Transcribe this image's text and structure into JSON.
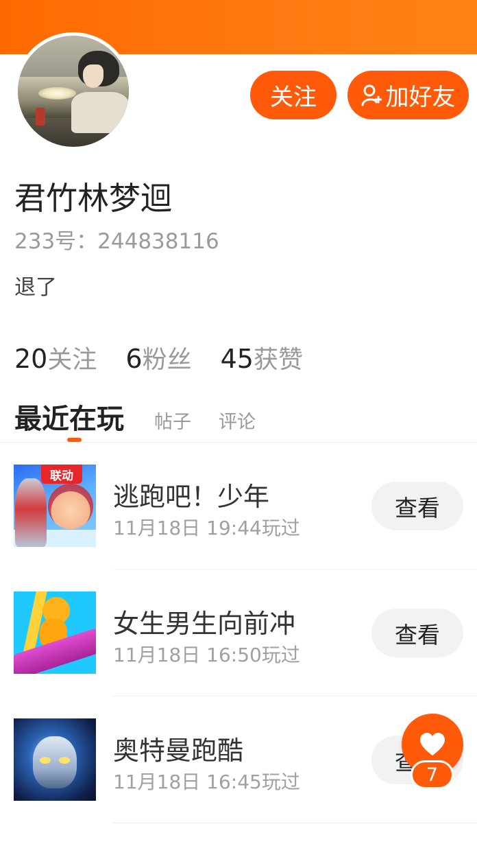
{
  "header": {
    "accent_color": "#ff6a00"
  },
  "profile": {
    "username": "君竹林梦迴",
    "account_id": "233号：244838116",
    "bio": "退了"
  },
  "actions": {
    "follow_label": "关注",
    "add_friend_label": "加好友",
    "add_friend_icon": "add-user-icon"
  },
  "stats": [
    {
      "num": "20",
      "label": "关注"
    },
    {
      "num": "6",
      "label": "粉丝"
    },
    {
      "num": "45",
      "label": "获赞"
    }
  ],
  "tabs": [
    {
      "label": "最近在玩",
      "active": true
    },
    {
      "label": "帖子",
      "active": false
    },
    {
      "label": "评论",
      "active": false
    }
  ],
  "games": [
    {
      "title": "逃跑吧！少年",
      "time": "11月18日 19:44玩过",
      "view_label": "查看",
      "badge": "联动"
    },
    {
      "title": "女生男生向前冲",
      "time": "11月18日 16:50玩过",
      "view_label": "查看"
    },
    {
      "title": "奥特曼跑酷",
      "time": "11月18日 16:45玩过",
      "view_label": "查看"
    }
  ],
  "like_fab": {
    "icon": "heart-icon",
    "count": "7"
  }
}
